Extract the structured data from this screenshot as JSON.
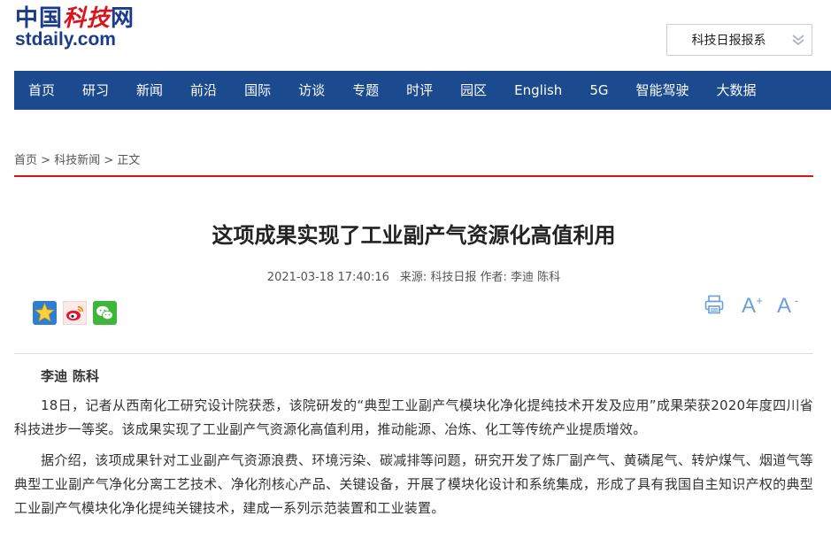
{
  "header": {
    "logo_cn_part1": "中国",
    "logo_cn_part2": "科技",
    "logo_cn_part3": "网",
    "logo_en": "stdaily.com",
    "brand_select": "科技日报报系"
  },
  "nav": {
    "items": [
      "首页",
      "研习",
      "新闻",
      "前沿",
      "国际",
      "访谈",
      "专题",
      "时评",
      "园区",
      "English",
      "5G",
      "智能驾驶",
      "大数据"
    ]
  },
  "breadcrumb": {
    "home": "首页",
    "sep1": ">",
    "section": "科技新闻",
    "sep2": ">",
    "current": "正文"
  },
  "article": {
    "title": "这项成果实现了工业副产气资源化高值利用",
    "datetime": "2021-03-18 17:40:16",
    "source": "来源: 科技日报",
    "author_line": "作者: 李迪 陈科",
    "byline": "李迪 陈科",
    "paragraphs": [
      "18日，记者从西南化工研究设计院获悉，该院研发的“典型工业副产气模块化净化提纯技术开发及应用”成果荣获2020年度四川省科技进步一等奖。该成果实现了工业副产气资源化高值利用，推动能源、冶炼、化工等传统产业提质增效。",
      "据介绍，该项成果针对工业副产气资源浪费、环境污染、碳减排等问题，研究开发了炼厂副产气、黄磷尾气、转炉煤气、烟道气等典型工业副产气净化分离工艺技术、净化剂核心产品、关键设备，开展了模块化设计和系统集成，形成了具有我国自主知识产权的典型工业副产气模块化净化提纯关键技术，建成一系列示范装置和工业装置。"
    ]
  },
  "share": {
    "icons": [
      "qzone-icon",
      "weibo-icon",
      "wechat-icon"
    ]
  },
  "tools": {
    "print_icon": "print-icon",
    "font_large": "A",
    "font_large_sign": "+",
    "font_small": "A",
    "font_small_sign": "-"
  },
  "colors": {
    "nav_bg": "#1c4a8e",
    "accent_red": "#d9141c",
    "logo_blue": "#1a3c8a",
    "tool_blue": "#6aa0d6"
  }
}
